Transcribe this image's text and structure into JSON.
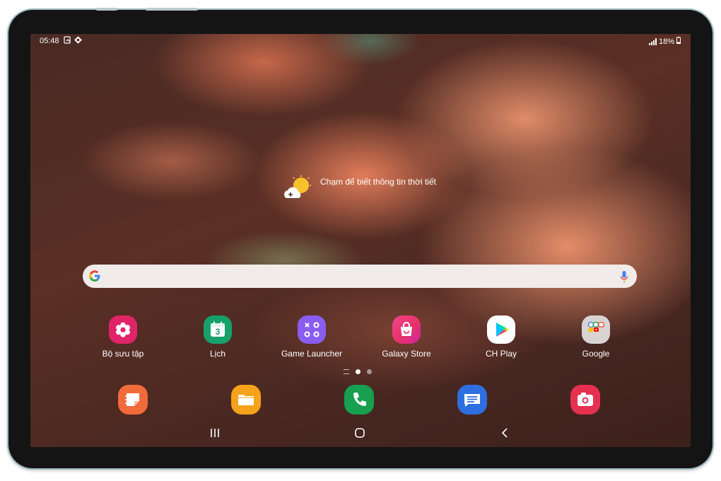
{
  "status_bar": {
    "time": "05:48",
    "left_icons": [
      "screenshot-icon",
      "settings-gear-icon"
    ],
    "battery": "18%"
  },
  "weather": {
    "text": "Chạm để biết thông tin thời tiết",
    "icon": "weather-add-icon"
  },
  "search_bar": {
    "left_icon": "google-g-icon",
    "right_icon": "microphone-icon"
  },
  "apps": [
    {
      "label": "Bộ sưu tập",
      "icon": "gallery-flower-icon",
      "color": "#e02467"
    },
    {
      "label": "Lịch",
      "icon": "calendar-icon",
      "color": "#16a06a",
      "badge": "3"
    },
    {
      "label": "Game Launcher",
      "icon": "game-launcher-icon",
      "color": "#8b5cf0"
    },
    {
      "label": "Galaxy Store",
      "icon": "shopping-bag-icon",
      "color": "#e8336a"
    },
    {
      "label": "CH Play",
      "icon": "play-store-icon",
      "color": "#ffffff"
    },
    {
      "label": "Google",
      "icon": "google-folder-icon",
      "color": "#d8d4d2"
    }
  ],
  "page_indicator": {
    "pages": 2,
    "current": 1
  },
  "dock": [
    {
      "icon": "samsung-notes-icon",
      "color": "#f06a3a"
    },
    {
      "icon": "my-files-folder-icon",
      "color": "#f7a21b"
    },
    {
      "icon": "phone-icon",
      "color": "#16a04f"
    },
    {
      "icon": "messages-icon",
      "color": "#2d6fe0"
    },
    {
      "icon": "camera-icon",
      "color": "#e6304f"
    }
  ],
  "nav_bar": [
    "recents-icon",
    "home-icon",
    "back-icon"
  ]
}
